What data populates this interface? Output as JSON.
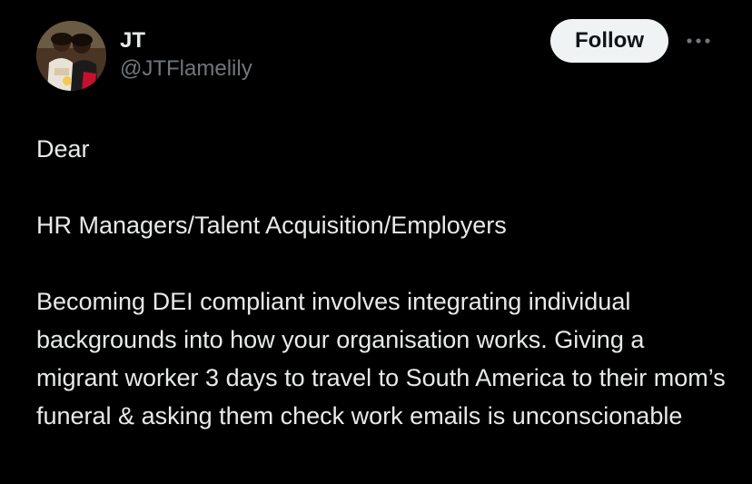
{
  "author": {
    "display_name": "JT",
    "handle": "@JTFlamelily"
  },
  "actions": {
    "follow_label": "Follow",
    "more_icon": "more-horizontal-icon"
  },
  "post": {
    "greeting": "Dear",
    "recipients": "HR Managers/Talent Acquisition/Employers",
    "body": "Becoming DEI compliant involves integrating individual backgrounds into how your organisation works. Giving a migrant worker 3 days to travel to South America to their mom’s funeral & asking them check work emails is unconscionable"
  },
  "colors": {
    "background": "#000000",
    "text_primary": "#e7e9ea",
    "text_secondary": "#71767b",
    "follow_bg": "#eff3f4",
    "follow_text": "#0f1419"
  }
}
